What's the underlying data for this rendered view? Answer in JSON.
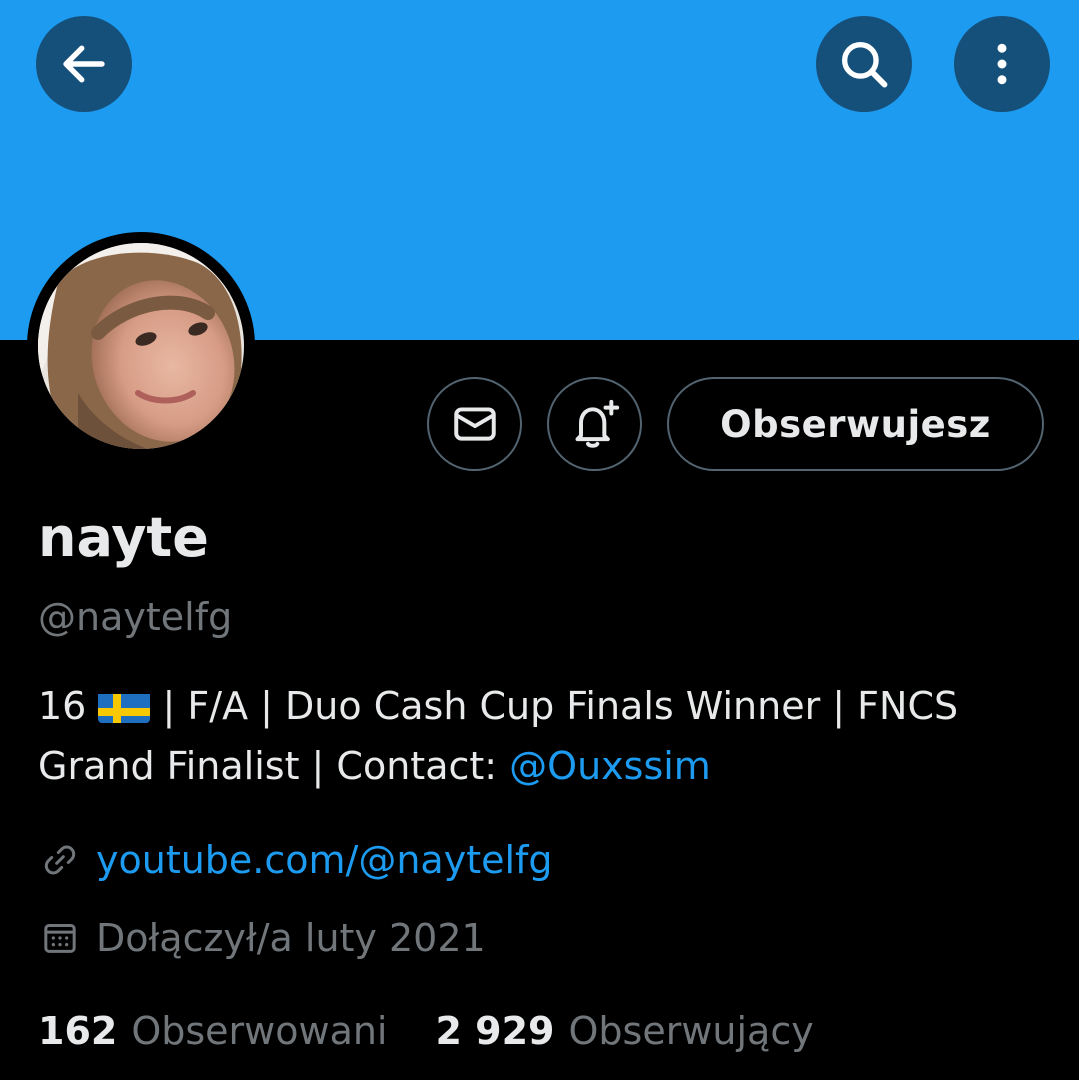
{
  "colors": {
    "banner": "#1d9bf0",
    "header_button_bg": "#15507a",
    "background": "#000000",
    "text_primary": "#e7e9ea",
    "text_secondary": "#71767b",
    "accent": "#1d9bf0",
    "button_border": "#536471"
  },
  "header": {
    "back_icon": "arrow-left-icon",
    "search_icon": "search-icon",
    "more_icon": "more-vertical-icon"
  },
  "actions": {
    "message_icon": "envelope-icon",
    "notify_icon": "bell-plus-icon",
    "follow_label": "Obserwujesz"
  },
  "profile": {
    "display_name": "nayte",
    "handle": "@naytelfg",
    "bio_prefix": "16",
    "bio_flag": "sweden-flag-icon",
    "bio_text": " | F/A | Duo Cash Cup Finals Winner | FNCS",
    "bio_line2": "Grand Finalist | Contact: ",
    "bio_mention": "@Ouxssim",
    "link_icon": "link-icon",
    "link": "youtube.com/@naytelfg",
    "calendar_icon": "calendar-icon",
    "joined": "Dołączył/a luty 2021"
  },
  "stats": {
    "following_count": "162",
    "following_label": "Obserwowani",
    "followers_count": "2 929",
    "followers_label": "Obserwujący"
  }
}
